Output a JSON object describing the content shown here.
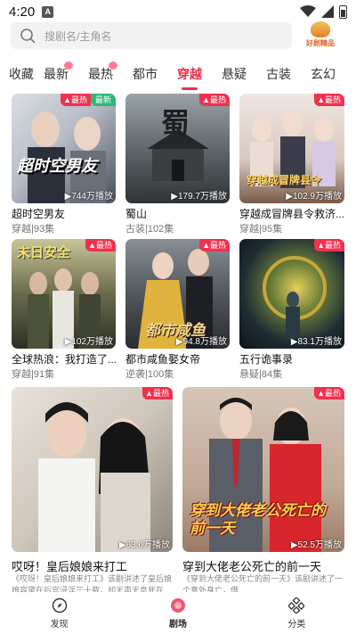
{
  "status": {
    "time": "4:20",
    "app_icon": "A"
  },
  "search": {
    "placeholder": "搜剧名/主角名"
  },
  "logo": {
    "text": "好剧精品"
  },
  "tabs": [
    "收藏",
    "最新",
    "最热",
    "都市",
    "穿越",
    "悬疑",
    "古装",
    "玄幻"
  ],
  "active_tab": "穿越",
  "colors": {
    "accent": "#e8324d",
    "hot_badge": "#f0314f",
    "new_badge": "#2fb77a"
  },
  "cards": [
    {
      "title": "超时空男友",
      "meta": "穿越|93集",
      "plays": "744万播放",
      "badge": "最热",
      "badge2": "最新",
      "poster_text": "超时空男友"
    },
    {
      "title": "蜀山",
      "meta": "古装|102集",
      "plays": "179.7万播放",
      "badge": "最热",
      "poster_text": "蜀"
    },
    {
      "title": "穿越成冒牌县令救济...",
      "meta": "穿越|95集",
      "plays": "102.9万播放",
      "badge": "最热",
      "poster_text": "穿越成冒牌县令"
    },
    {
      "title": "全球热浪：我打造了...",
      "meta": "穿越|91集",
      "plays": "102万播放",
      "badge": "最热",
      "poster_text": "末日安全"
    },
    {
      "title": "都市咸鱼娶女帝",
      "meta": "逆袭|100集",
      "plays": "94.8万播放",
      "badge": "最热",
      "poster_text": "都市咸鱼"
    },
    {
      "title": "五行诡事录",
      "meta": "悬疑|84集",
      "plays": "83.1万播放",
      "badge": "最热",
      "poster_text": ""
    },
    {
      "title": "哎呀！皇后娘娘来打工",
      "desc": "《哎呀！皇后娘娘来打工》该剧讲述了皇后娘娘容黛在后宫浸淫三十载，却无声无息死在...",
      "plays": "63.6万播放",
      "badge": "最热",
      "poster_text": ""
    },
    {
      "title": "穿到大佬老公死亡的前一天",
      "desc": "《穿到大佬老公死亡的前一天》该剧讲述了一个意外身亡，借...",
      "plays": "52.5万播放",
      "badge": "最热",
      "poster_text": "穿到大佬老公死亡的前一天"
    }
  ],
  "bottom_nav": [
    {
      "label": "发现",
      "icon": "compass-icon"
    },
    {
      "label": "剧场",
      "icon": "theater-icon"
    },
    {
      "label": "分类",
      "icon": "category-icon"
    }
  ],
  "active_nav": "剧场"
}
